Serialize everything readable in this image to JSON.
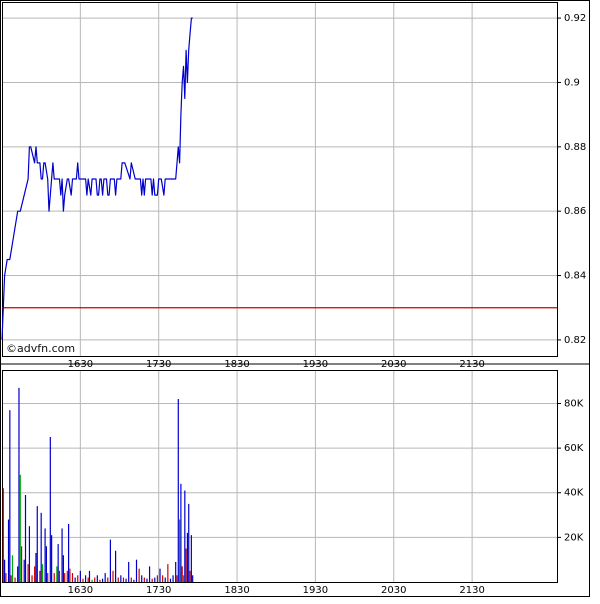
{
  "watermark": "©advfn.com",
  "colors": {
    "price_line": "#0000cc",
    "reference_line": "#cc0000",
    "grid": "#b8b8b8",
    "frame": "#000000",
    "vol_up": "#00aa00",
    "vol_down": "#cc0000",
    "vol_neutral": "#0000cc"
  },
  "chart_data": [
    {
      "type": "line",
      "title": "",
      "xlabel": "",
      "ylabel": "",
      "x_ticks": [
        "1630",
        "1730",
        "1830",
        "1930",
        "2030",
        "2130"
      ],
      "y_ticks": [
        "0.92",
        "0.9",
        "0.88",
        "0.86",
        "0.84",
        "0.82"
      ],
      "xlim": [
        "1530",
        "2235"
      ],
      "ylim": [
        0.815,
        0.925
      ],
      "grid": true,
      "reference_line": 0.83,
      "series": [
        {
          "x": [
            "1530",
            "1532",
            "1534",
            "1536",
            "1542",
            "1544",
            "1550",
            "1551",
            "1552",
            "1555",
            "1556",
            "1557",
            "1559",
            "1600",
            "1601",
            "1602",
            "1603",
            "1605",
            "1606",
            "1608",
            "1609",
            "1610",
            "1611",
            "1612",
            "1613",
            "1614",
            "1615",
            "1616",
            "1617",
            "1618",
            "1620",
            "1621",
            "1623",
            "1624",
            "1626",
            "1627",
            "1628",
            "1629",
            "1630",
            "1631",
            "1632",
            "1634",
            "1635",
            "1636",
            "1638",
            "1639",
            "1642",
            "1643",
            "1644",
            "1645",
            "1646",
            "1647",
            "1648",
            "1650",
            "1651",
            "1652",
            "1653",
            "1654",
            "1656",
            "1657",
            "1658",
            "1659",
            "1700",
            "1701",
            "1702",
            "1703",
            "1704",
            "1708",
            "1709",
            "1712",
            "1713",
            "1714",
            "1716",
            "1717",
            "1718",
            "1719",
            "1720",
            "1721",
            "1722",
            "1724",
            "1725",
            "1726",
            "1727",
            "1729",
            "1730",
            "1731",
            "1732",
            "1734",
            "1735",
            "1736",
            "1737",
            "1738",
            "1739",
            "1740",
            "1741",
            "1743",
            "1744",
            "1745",
            "1746",
            "1747",
            "1748",
            "1749",
            "1750",
            "1751",
            "1752",
            "1753",
            "1754",
            "1755",
            "1756"
          ],
          "y": [
            0.82,
            0.84,
            0.845,
            0.845,
            0.86,
            0.86,
            0.87,
            0.88,
            0.88,
            0.875,
            0.88,
            0.875,
            0.875,
            0.87,
            0.87,
            0.875,
            0.875,
            0.87,
            0.86,
            0.87,
            0.875,
            0.87,
            0.87,
            0.87,
            0.87,
            0.87,
            0.865,
            0.87,
            0.86,
            0.865,
            0.87,
            0.87,
            0.865,
            0.87,
            0.87,
            0.87,
            0.875,
            0.87,
            0.87,
            0.87,
            0.87,
            0.87,
            0.865,
            0.87,
            0.865,
            0.87,
            0.87,
            0.865,
            0.865,
            0.87,
            0.87,
            0.865,
            0.87,
            0.87,
            0.865,
            0.865,
            0.87,
            0.87,
            0.87,
            0.865,
            0.87,
            0.87,
            0.87,
            0.87,
            0.875,
            0.875,
            0.875,
            0.87,
            0.875,
            0.87,
            0.87,
            0.87,
            0.87,
            0.865,
            0.87,
            0.865,
            0.87,
            0.87,
            0.87,
            0.87,
            0.865,
            0.87,
            0.865,
            0.865,
            0.87,
            0.87,
            0.87,
            0.865,
            0.87,
            0.87,
            0.87,
            0.87,
            0.87,
            0.87,
            0.87,
            0.87,
            0.875,
            0.88,
            0.875,
            0.89,
            0.9,
            0.905,
            0.895,
            0.91,
            0.9,
            0.91,
            0.915,
            0.92,
            0.92
          ]
        }
      ]
    },
    {
      "type": "bar",
      "title": "",
      "xlabel": "",
      "ylabel": "",
      "x_ticks": [
        "1630",
        "1730",
        "1830",
        "1930",
        "2030",
        "2130"
      ],
      "y_ticks": [
        "80K",
        "60K",
        "40K",
        "20K"
      ],
      "xlim": [
        "1530",
        "2235"
      ],
      "ylim": [
        0,
        95000
      ],
      "grid": true,
      "series": [
        {
          "name": "",
          "x": [
            "1531",
            "1532",
            "1533",
            "1535",
            "1536",
            "1537",
            "1538",
            "1540",
            "1542",
            "1543",
            "1544",
            "1545",
            "1547",
            "1548",
            "1550",
            "1551",
            "1553",
            "1555",
            "1556",
            "1557",
            "1559",
            "1600",
            "1601",
            "1603",
            "1604",
            "1605",
            "1607",
            "1608",
            "1610",
            "1612",
            "1613",
            "1614",
            "1616",
            "1617",
            "1618",
            "1620",
            "1621",
            "1622",
            "1624",
            "1626",
            "1628",
            "1630",
            "1632",
            "1634",
            "1636",
            "1637",
            "1639",
            "1641",
            "1643",
            "1645",
            "1647",
            "1649",
            "1651",
            "1653",
            "1655",
            "1657",
            "1659",
            "1701",
            "1703",
            "1705",
            "1707",
            "1709",
            "1711",
            "1713",
            "1715",
            "1717",
            "1719",
            "1721",
            "1723",
            "1725",
            "1727",
            "1729",
            "1731",
            "1733",
            "1735",
            "1737",
            "1739",
            "1741",
            "1743",
            "1744",
            "1745",
            "1746",
            "1747",
            "1748",
            "1749",
            "1750",
            "1751",
            "1752",
            "1753",
            "1754",
            "1755",
            "1756"
          ],
          "values": [
            42000,
            10000,
            4000,
            28000,
            77000,
            3000,
            12000,
            2000,
            7000,
            87000,
            48000,
            16000,
            10000,
            39000,
            8000,
            25000,
            3000,
            7000,
            13000,
            34000,
            5000,
            31000,
            8000,
            24000,
            16000,
            4000,
            65000,
            21000,
            4000,
            7000,
            17000,
            5000,
            24000,
            12000,
            4000,
            5000,
            26000,
            6000,
            4000,
            2000,
            3000,
            5000,
            1500,
            3000,
            2000,
            5000,
            1000,
            2000,
            3000,
            1000,
            1500,
            4000,
            2000,
            19000,
            5000,
            14000,
            2000,
            3000,
            2000,
            1500,
            9000,
            2000,
            1000,
            10000,
            6000,
            3000,
            2000,
            1500,
            7000,
            1500,
            2000,
            3000,
            6000,
            3000,
            2000,
            8000,
            1500,
            3000,
            9000,
            3000,
            82000,
            28000,
            44000,
            7000,
            3000,
            41000,
            15000,
            22000,
            35000,
            5000,
            21000,
            3000
          ],
          "direction": [
            "down",
            "neutral",
            "down",
            "neutral",
            "neutral",
            "down",
            "up",
            "down",
            "neutral",
            "neutral",
            "up",
            "down",
            "neutral",
            "neutral",
            "down",
            "neutral",
            "down",
            "down",
            "neutral",
            "neutral",
            "down",
            "neutral",
            "up",
            "neutral",
            "neutral",
            "down",
            "neutral",
            "neutral",
            "down",
            "up",
            "neutral",
            "down",
            "neutral",
            "neutral",
            "down",
            "down",
            "neutral",
            "down",
            "down",
            "neutral",
            "down",
            "neutral",
            "down",
            "neutral",
            "down",
            "neutral",
            "up",
            "down",
            "neutral",
            "down",
            "neutral",
            "neutral",
            "down",
            "neutral",
            "down",
            "neutral",
            "down",
            "neutral",
            "down",
            "neutral",
            "neutral",
            "down",
            "neutral",
            "neutral",
            "down",
            "neutral",
            "down",
            "neutral",
            "neutral",
            "down",
            "neutral",
            "down",
            "neutral",
            "down",
            "neutral",
            "down",
            "neutral",
            "neutral",
            "neutral",
            "down",
            "neutral",
            "up",
            "neutral",
            "down",
            "up",
            "neutral",
            "down",
            "neutral",
            "neutral",
            "down",
            "neutral",
            "neutral"
          ]
        }
      ]
    }
  ]
}
